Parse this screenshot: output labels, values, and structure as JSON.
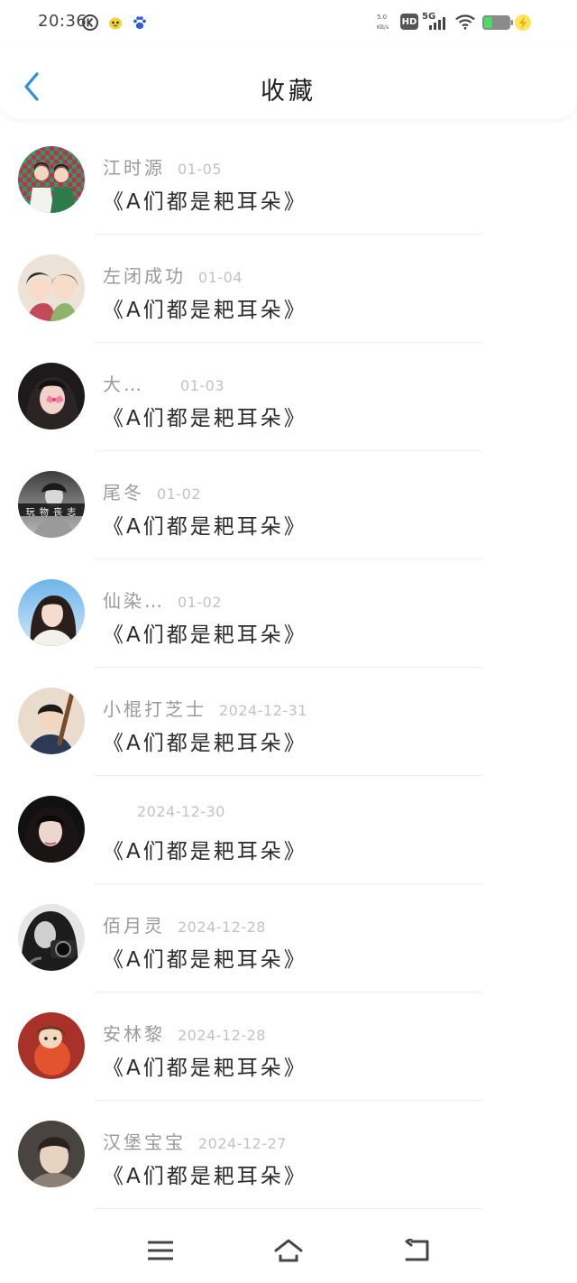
{
  "status_bar": {
    "time": "20:36",
    "left_icons": [
      "k-circle-icon",
      "chick-icon",
      "paw-icon"
    ],
    "right_icons": [
      "network-speed-icon",
      "hd-icon",
      "signal-5g-icon",
      "wifi-icon",
      "battery-charging-icon"
    ],
    "hd_label": "HD",
    "network_label": "5G",
    "colors": {
      "battery": "#4cd964",
      "charge_bolt": "#f5c518"
    }
  },
  "header": {
    "back_icon": "chevron-left-icon",
    "title": "收藏",
    "accent_color": "#2f8ee0"
  },
  "favorites": [
    {
      "name": "江时源",
      "date": "01-05",
      "title": "《A们都是耙耳朵》",
      "avatar": "couple-red-background"
    },
    {
      "name": "左闭成功",
      "date": "01-04",
      "title": "《A们都是耙耳朵》",
      "avatar": "illustrated-pair"
    },
    {
      "name": "大…",
      "date": "01-03",
      "title": "《A们都是耙耳朵》",
      "avatar": "girl-pink-bow"
    },
    {
      "name": "尾冬",
      "date": "01-02",
      "title": "《A们都是耙耳朵》",
      "avatar": "grayscale-photo",
      "avatar_text": "玩 物 丧 志"
    },
    {
      "name": "仙染…",
      "date": "01-02",
      "title": "《A们都是耙耳朵》",
      "avatar": "girl-blue-sky"
    },
    {
      "name": "小棍打芝士",
      "date": "2024-12-31",
      "title": "《A们都是耙耳朵》",
      "avatar": "boy-with-bat"
    },
    {
      "name": "",
      "date": "2024-12-30",
      "title": "《A们都是耙耳朵》",
      "avatar": "dark-hair-girl"
    },
    {
      "name": "佰月灵",
      "date": "2024-12-28",
      "title": "《A们都是耙耳朵》",
      "avatar": "camera-bw"
    },
    {
      "name": "安林黎",
      "date": "2024-12-28",
      "title": "《A们都是耙耳朵》",
      "avatar": "cartoon-tomato"
    },
    {
      "name": "汉堡宝宝",
      "date": "2024-12-27",
      "title": "《A们都是耙耳朵》",
      "avatar": "boy-portrait"
    }
  ],
  "nav_bar": {
    "buttons": [
      "menu-icon",
      "home-icon",
      "back-icon"
    ]
  }
}
